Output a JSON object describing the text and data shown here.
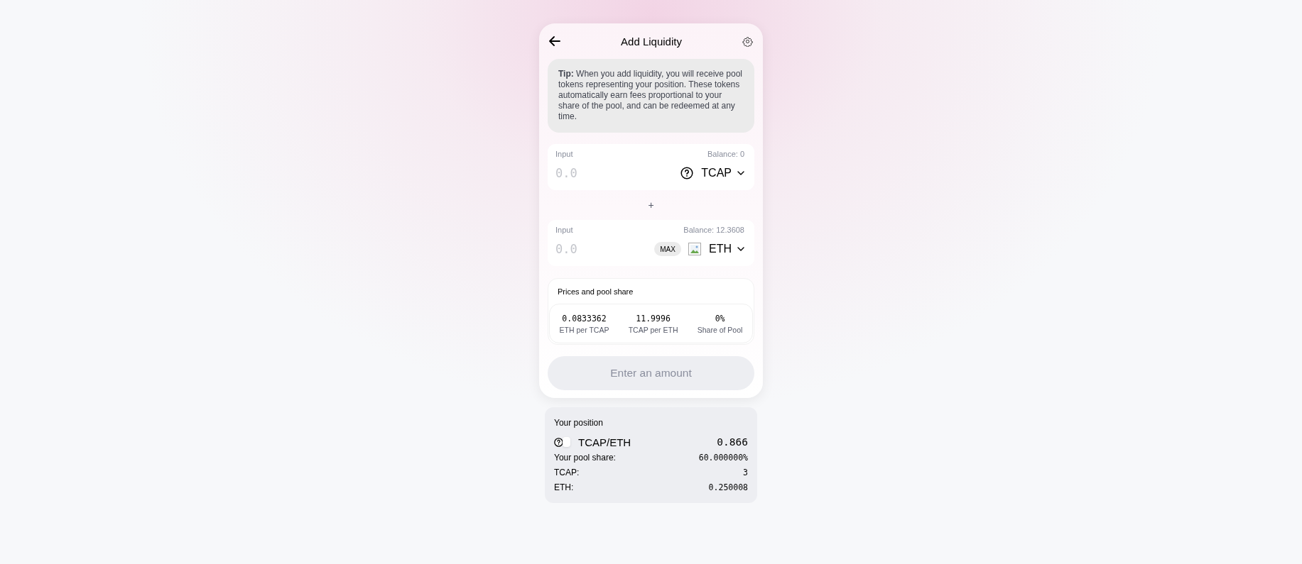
{
  "header": {
    "title": "Add Liquidity"
  },
  "tip": {
    "text": "**Tip:** When you add liquidity, you will receive pool tokens representing your position. These tokens automatically earn fees proportional to your share of the pool, and can be redeemed at any time."
  },
  "inputs": [
    {
      "kind": "unknown",
      "label": "Input",
      "balance": "Balance: 0",
      "placeholder": "0.0",
      "token": "TCAP"
    },
    {
      "kind": "image",
      "label": "Input",
      "balance": "Balance: 12.3608",
      "placeholder": "0.0",
      "max": "MAX",
      "token": "ETH"
    }
  ],
  "separator": "+",
  "prices": {
    "title": "Prices and pool share",
    "items": [
      {
        "value": "0.0833362",
        "label": "ETH per TCAP"
      },
      {
        "value": "11.9996",
        "label": "TCAP per ETH"
      },
      {
        "value": "0%",
        "label": "Share of Pool"
      }
    ]
  },
  "submit": {
    "label": "Enter an amount",
    "disabled": true
  },
  "position": {
    "title": "Your position",
    "pair": "TCAP/ETH",
    "amount": "0.866",
    "rows": [
      {
        "label": "Your pool share:",
        "value": "60.000000%"
      },
      {
        "label": "TCAP:",
        "value": "3"
      },
      {
        "label": "ETH:",
        "value": "0.250008"
      }
    ]
  }
}
